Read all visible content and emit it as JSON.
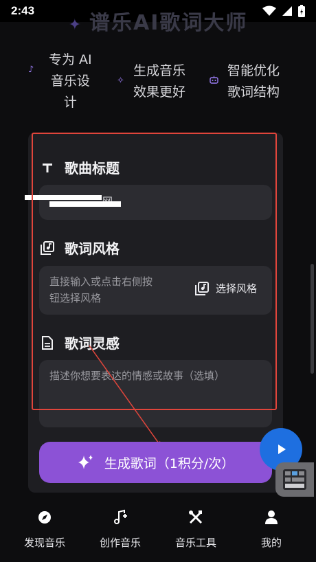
{
  "status_bar": {
    "time": "2:43"
  },
  "header": {
    "title": "谱乐AI歌词大师"
  },
  "features": [
    {
      "icon": "music-note-icon",
      "lines": [
        "专为 AI",
        "音乐设",
        "计"
      ]
    },
    {
      "icon": "sparkle-icon",
      "lines": [
        "生成音乐",
        "效果更好"
      ]
    },
    {
      "icon": "robot-icon",
      "lines": [
        "智能优化",
        "歌词结构"
      ]
    }
  ],
  "form": {
    "title_section": {
      "label": "歌曲标题",
      "value": "网"
    },
    "style_section": {
      "label": "歌词风格",
      "placeholder_lines": [
        "直接输入或点击右侧按",
        "钮选择风格"
      ],
      "select_button": "选择风格"
    },
    "inspiration_section": {
      "label": "歌词灵感",
      "placeholder": "描述你想要表达的情感或故事（选填）"
    }
  },
  "generate_button": {
    "label": "生成歌词（1积分/次）"
  },
  "bottom_nav": [
    {
      "label": "发现音乐",
      "icon": "compass-icon"
    },
    {
      "label": "创作音乐",
      "icon": "music-create-icon"
    },
    {
      "label": "音乐工具",
      "icon": "tools-icon"
    },
    {
      "label": "我的",
      "icon": "user-icon"
    }
  ],
  "colors": {
    "accent": "#8c52d6",
    "fab": "#1e6fe0",
    "highlight": "#e0453b"
  }
}
